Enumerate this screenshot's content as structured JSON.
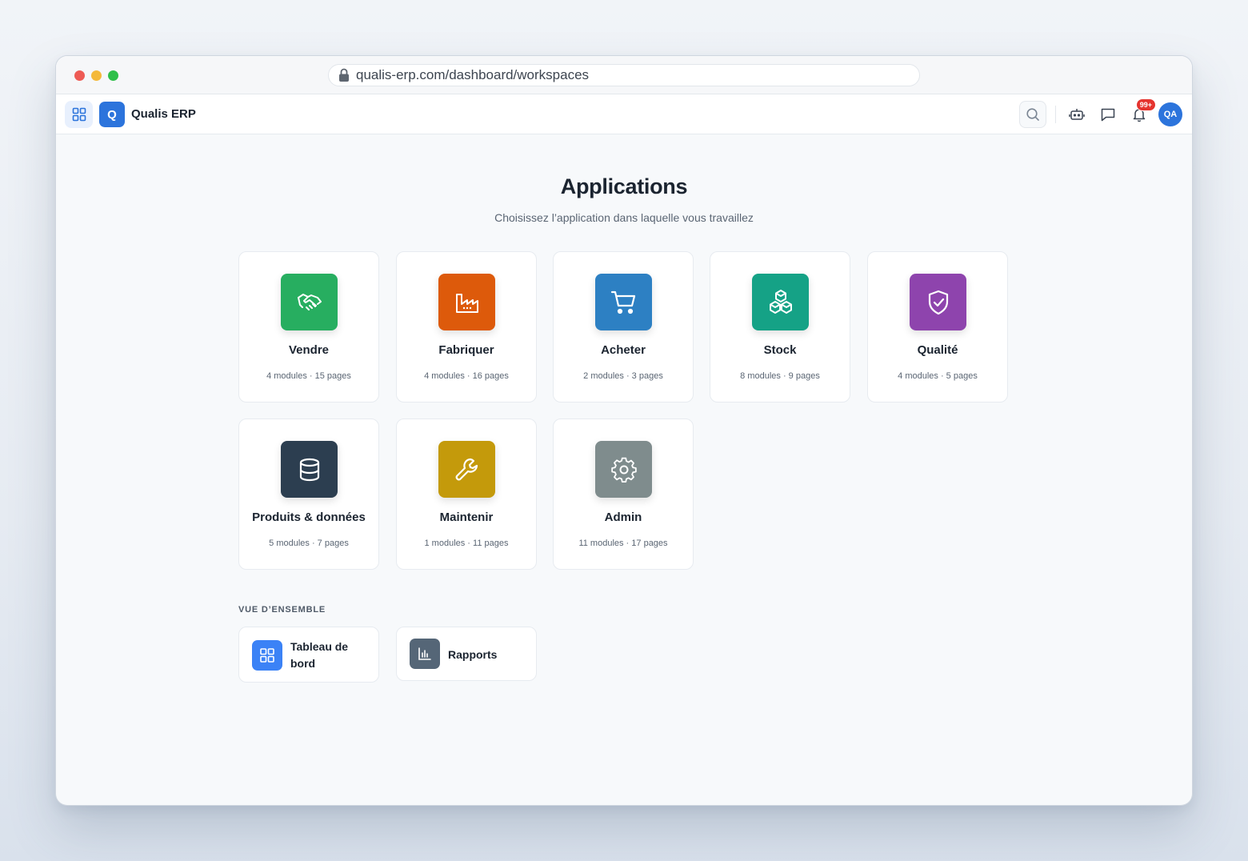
{
  "browser": {
    "url": "qualis-erp.com/dashboard/workspaces"
  },
  "appbar": {
    "logo_letter": "Q",
    "brand": "Qualis ERP",
    "notifications_badge": "99+",
    "avatar_initials": "QA"
  },
  "page": {
    "title": "Applications",
    "subtitle": "Choisissez l’application dans laquelle vous travaillez"
  },
  "apps": [
    {
      "name": "Vendre",
      "meta": "4 modules · 15 pages",
      "icon": "handshake-icon",
      "color": "#27ae60"
    },
    {
      "name": "Fabriquer",
      "meta": "4 modules · 16 pages",
      "icon": "factory-icon",
      "color": "#dd5a0b"
    },
    {
      "name": "Acheter",
      "meta": "2 modules · 3 pages",
      "icon": "cart-icon",
      "color": "#2d80c3"
    },
    {
      "name": "Stock",
      "meta": "8 modules · 9 pages",
      "icon": "boxes-icon",
      "color": "#15a286"
    },
    {
      "name": "Qualité",
      "meta": "4 modules · 5 pages",
      "icon": "shield-check-icon",
      "color": "#8e44ad"
    },
    {
      "name": "Produits & données",
      "meta": "5 modules · 7 pages",
      "icon": "database-icon",
      "color": "#2c3e50"
    },
    {
      "name": "Maintenir",
      "meta": "1 modules · 11 pages",
      "icon": "wrench-icon",
      "color": "#c49a0b"
    },
    {
      "name": "Admin",
      "meta": "11 modules · 17 pages",
      "icon": "gear-icon",
      "color": "#7f8c8d"
    }
  ],
  "overview": {
    "label": "VUE D’ENSEMBLE",
    "items": [
      {
        "line1": "Tableau de",
        "line2": "bord",
        "icon": "dashboard-grid-icon",
        "color": "#3b82f6"
      },
      {
        "label": "Rapports",
        "icon": "bar-chart-icon",
        "color": "#556677"
      }
    ]
  }
}
